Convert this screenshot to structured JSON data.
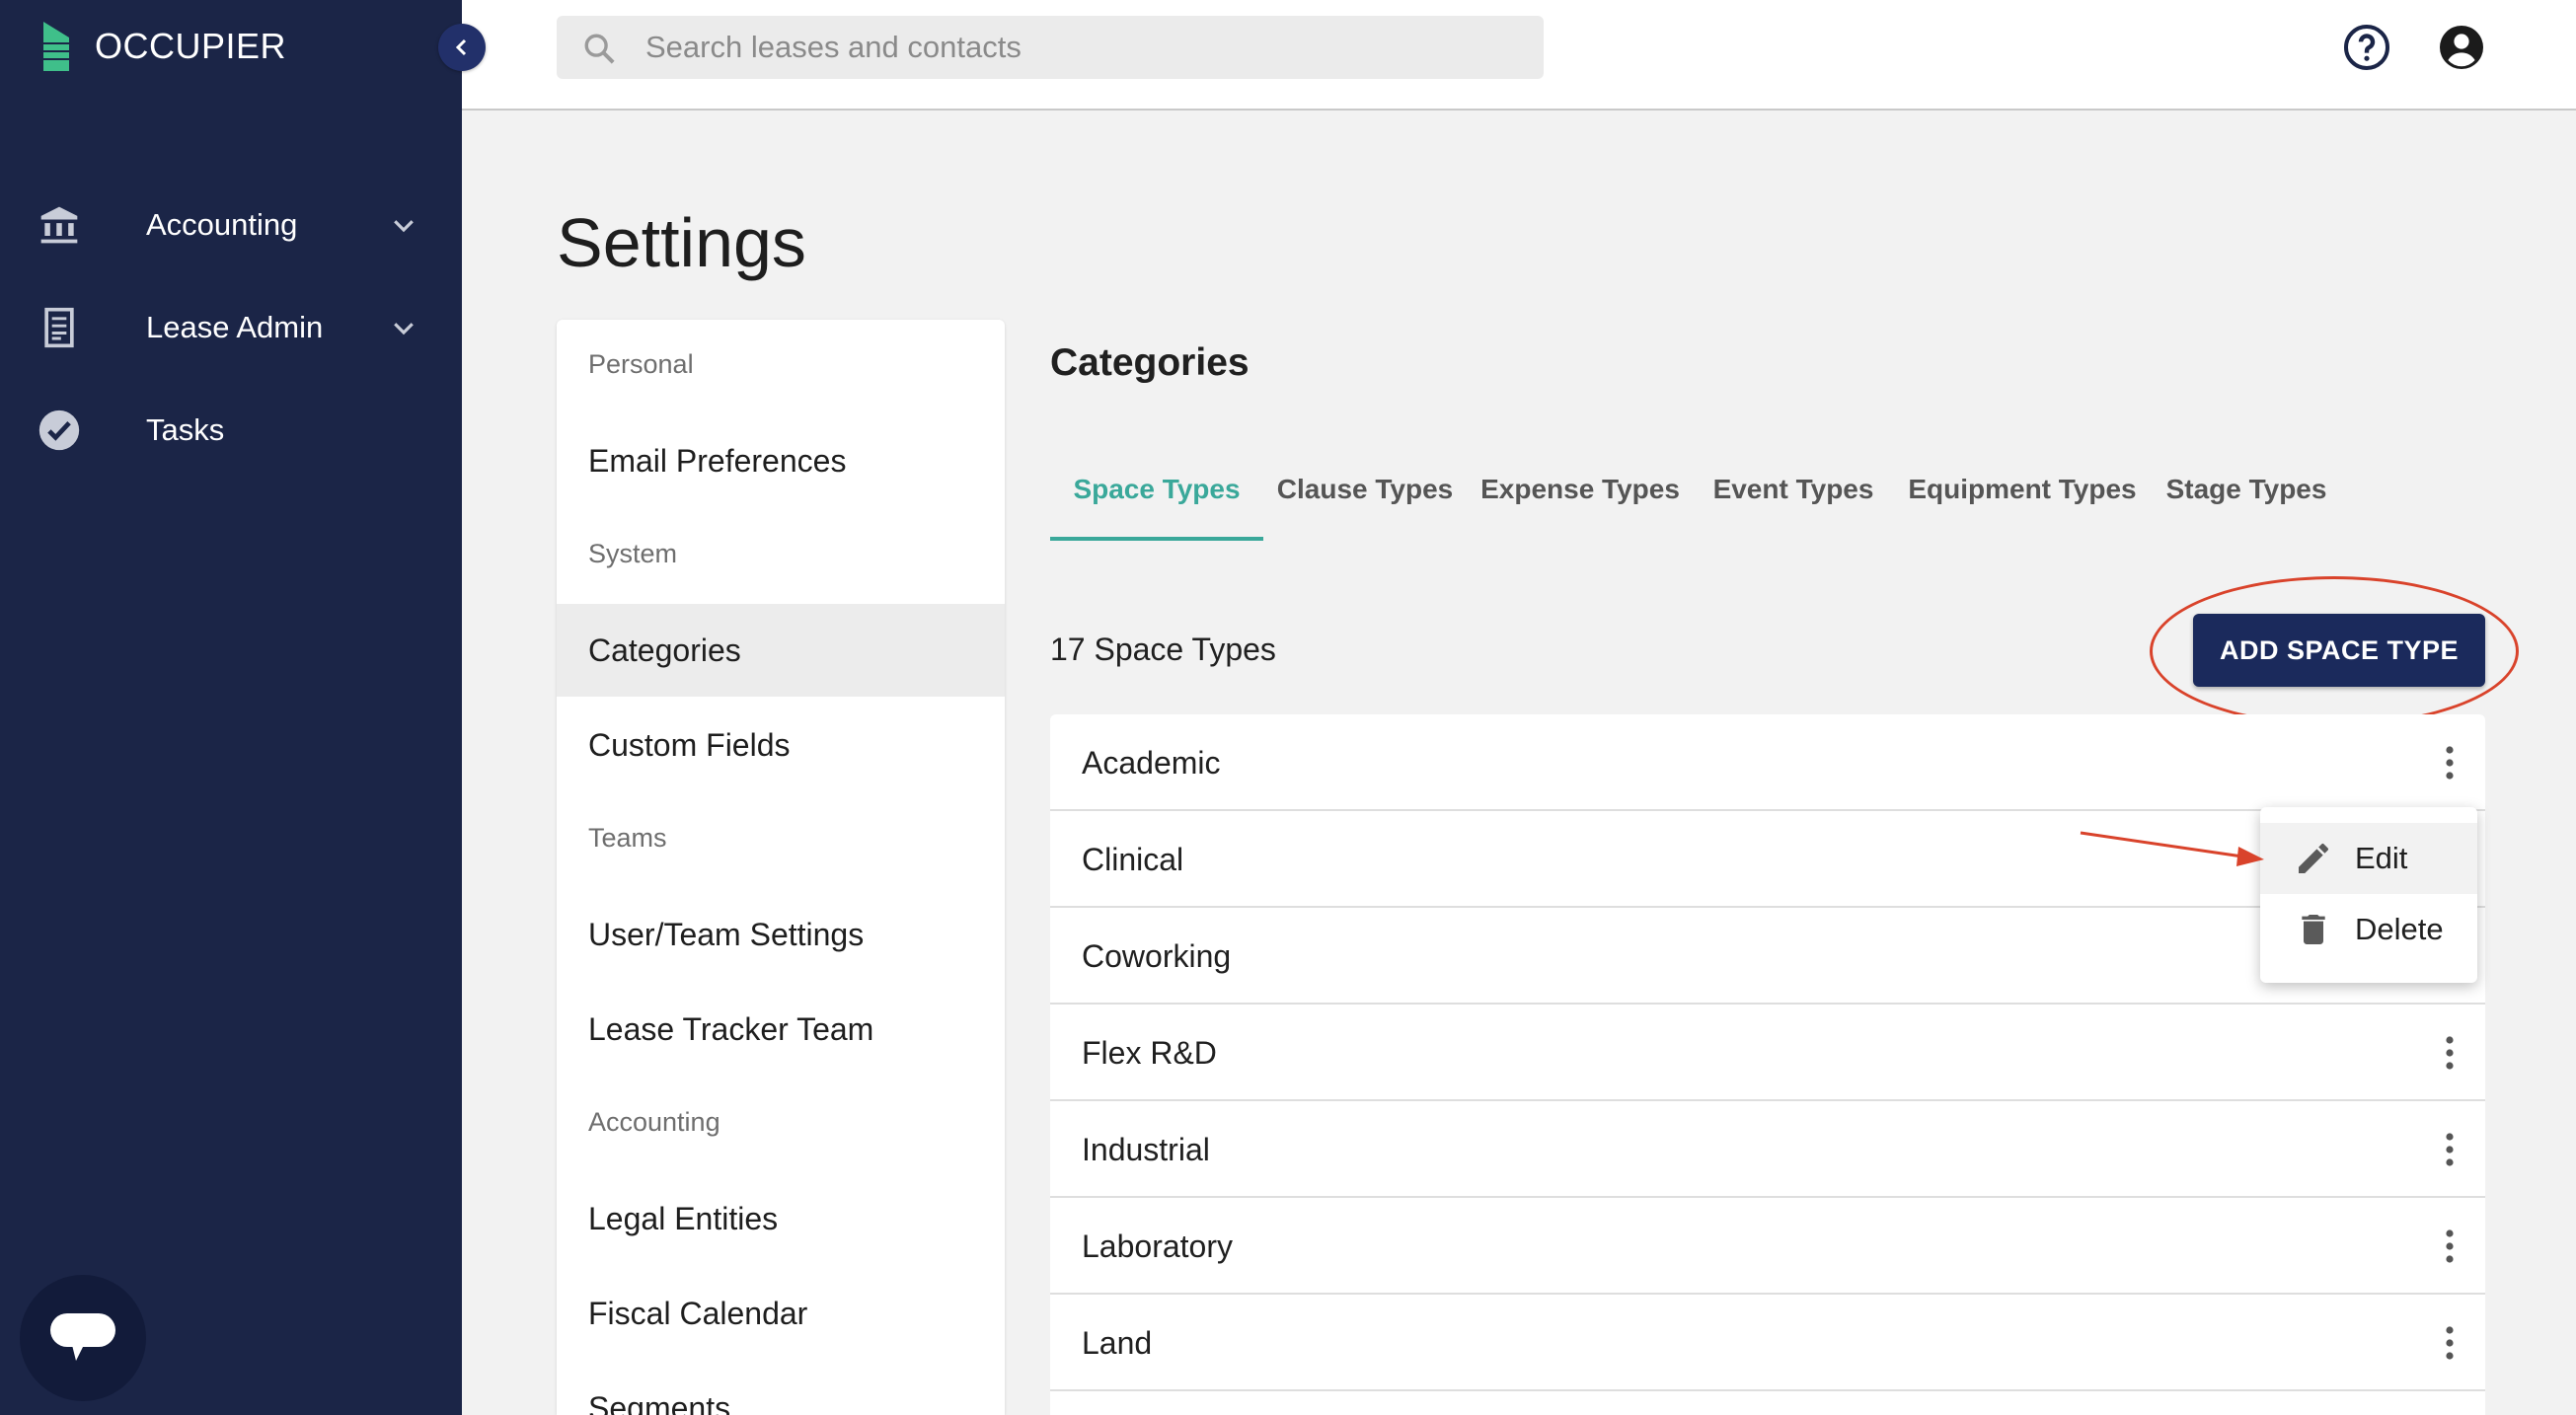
{
  "app": {
    "brand": "OCCUPIER",
    "brand_color": "#3fbf8a"
  },
  "sidebar": {
    "items": [
      {
        "label": "Accounting",
        "icon": "bank-icon",
        "expandable": true
      },
      {
        "label": "Lease Admin",
        "icon": "document-icon",
        "expandable": true
      },
      {
        "label": "Tasks",
        "icon": "check-circle-icon",
        "expandable": false
      }
    ]
  },
  "topbar": {
    "search_placeholder": "Search leases and contacts"
  },
  "page": {
    "title": "Settings"
  },
  "settings_menu": {
    "sections": [
      {
        "heading": "Personal",
        "links": [
          "Email Preferences"
        ]
      },
      {
        "heading": "System",
        "links": [
          "Categories",
          "Custom Fields"
        ]
      },
      {
        "heading": "Teams",
        "links": [
          "User/Team Settings",
          "Lease Tracker Team"
        ]
      },
      {
        "heading": "Accounting",
        "links": [
          "Legal Entities",
          "Fiscal Calendar",
          "Segments"
        ]
      }
    ],
    "active": "Categories"
  },
  "categories": {
    "title": "Categories",
    "tabs": [
      "Space Types",
      "Clause Types",
      "Expense Types",
      "Event Types",
      "Equipment Types",
      "Stage Types"
    ],
    "active_tab": "Space Types",
    "count_label": "17 Space Types",
    "add_button": "ADD SPACE TYPE",
    "rows": [
      "Academic",
      "Clinical",
      "Coworking",
      "Flex R&D",
      "Industrial",
      "Laboratory",
      "Land"
    ]
  },
  "context_menu": {
    "items": [
      {
        "label": "Edit",
        "icon": "pencil-icon"
      },
      {
        "label": "Delete",
        "icon": "trash-icon"
      }
    ]
  },
  "colors": {
    "sidebar_bg": "#1b2547",
    "accent_teal": "#3aa89a",
    "primary_button": "#1b2a5c",
    "annotation_red": "#d9432b"
  }
}
